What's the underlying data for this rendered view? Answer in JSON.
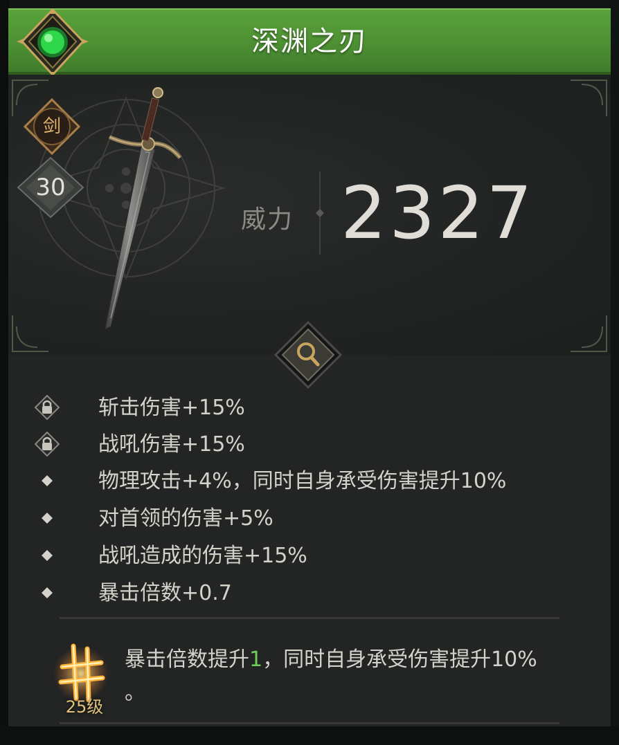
{
  "item": {
    "name": "深渊之刃",
    "type_badge": "剑",
    "level": "30",
    "power_label": "威力",
    "power_value": "2327"
  },
  "stats": [
    {
      "icon": "lock-icon",
      "text": "斩击伤害+15%"
    },
    {
      "icon": "lock-icon",
      "text": "战吼伤害+15%"
    },
    {
      "icon": "diamond-bullet-icon",
      "text": "物理攻击+4%，同时自身承受伤害提升10%"
    },
    {
      "icon": "diamond-bullet-icon",
      "text": "对首领的伤害+5%"
    },
    {
      "icon": "diamond-bullet-icon",
      "text": "战吼造成的伤害+15%"
    },
    {
      "icon": "diamond-bullet-icon",
      "text": "暴击倍数+0.7"
    }
  ],
  "skill": {
    "level_label": "25级",
    "text_before": "暴击倍数提升",
    "highlight": "1",
    "text_after": "，同时自身承受伤害提升10%",
    "text_line2": "。",
    "highlight_color": "#6fd15a"
  },
  "colors": {
    "header_green": "#4d8f33",
    "gem_green": "#2fd84a",
    "gold": "#e2b46e"
  }
}
